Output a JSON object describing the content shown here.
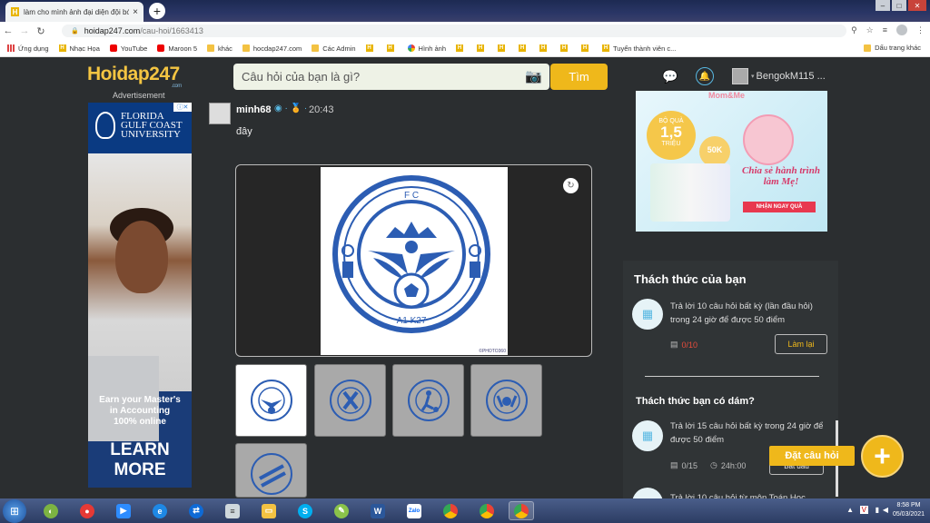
{
  "browser": {
    "tab_title": "làm cho mình ảnh đại diện đội bóng",
    "tab_close": "×",
    "new_tab": "+",
    "url_host": "hoidap247.com",
    "url_path": "/cau-hoi/1663413",
    "bookmarks": [
      {
        "label": "Ứng dụng",
        "icon": "apps"
      },
      {
        "label": "Nhạc Họa",
        "icon": "h"
      },
      {
        "label": "YouTube",
        "icon": "yt"
      },
      {
        "label": "Maroon 5",
        "icon": "yt"
      },
      {
        "label": "khác",
        "icon": "fold"
      },
      {
        "label": "hocdap247.com",
        "icon": "fold"
      },
      {
        "label": "Các Admin",
        "icon": "fold"
      },
      {
        "label": "",
        "icon": "h"
      },
      {
        "label": "",
        "icon": "h"
      },
      {
        "label": "Hình ảnh",
        "icon": "g"
      },
      {
        "label": "",
        "icon": "h"
      },
      {
        "label": "",
        "icon": "h"
      },
      {
        "label": "",
        "icon": "h"
      },
      {
        "label": "",
        "icon": "h"
      },
      {
        "label": "",
        "icon": "h"
      },
      {
        "label": "",
        "icon": "h"
      },
      {
        "label": "",
        "icon": "h"
      },
      {
        "label": "Tuyển thành viên c...",
        "icon": "h"
      }
    ],
    "bookmark_other": "Dấu trang khác"
  },
  "site": {
    "logo": "Hoidap247",
    "logo_suffix": ".com",
    "search_placeholder": "Câu hỏi của bạn là gì?",
    "search_button": "Tìm",
    "username": "BengokM115 ..."
  },
  "ad_left": {
    "label": "Advertisement",
    "school_line1": "FLORIDA",
    "school_line2": "GULF COAST",
    "school_line3": "UNIVERSITY",
    "line1": "Earn your Master's",
    "line2": "in Accounting",
    "line3": "100% online",
    "cta1": "LEARN",
    "cta2": "MORE"
  },
  "post": {
    "author": "minh68",
    "time": "20:43",
    "separator": "·",
    "text": "đây",
    "watermark": "©PHOTO360",
    "crest_top": "F C",
    "crest_bottom": "A1 K27",
    "thumb_count": 5
  },
  "ad_right": {
    "brand": "Mom&Me",
    "gift_label": "BỘ QUÀ",
    "gift_value": "1,5",
    "gift_unit": "TRIỆU",
    "voucher": "50K",
    "message_line1": "Chia sẻ hành trình",
    "message_line2": "làm Mẹ!",
    "cta": "NHẬN NGAY QUÀ"
  },
  "challenges": {
    "title": "Thách thức của bạn",
    "item1_text": "Trả lời 10 câu hỏi  bất kỳ (lần đầu hỏi) trong 24 giờ để được 50 điểm",
    "item1_progress": "0/10",
    "item1_button": "Làm lại",
    "section2_title": "Thách thức bạn có dám?",
    "item2_text": "Trả lời 15 câu hỏi  bất kỳ  trong 24 giờ để được 50 điểm",
    "item2_progress": "0/15",
    "item2_time": "24h:00",
    "item2_button": "Bắt đầu",
    "item3_text": "Trả lời 10 câu hỏi  từ môn Toán Học",
    "ask_button": "Đặt câu hỏi",
    "plus": "+"
  },
  "taskbar": {
    "time": "8:58 PM",
    "date": "05/03/2021"
  },
  "colors": {
    "accent": "#efb81b",
    "page_bg": "#2b2e30",
    "link_blue": "#58b8e2"
  }
}
